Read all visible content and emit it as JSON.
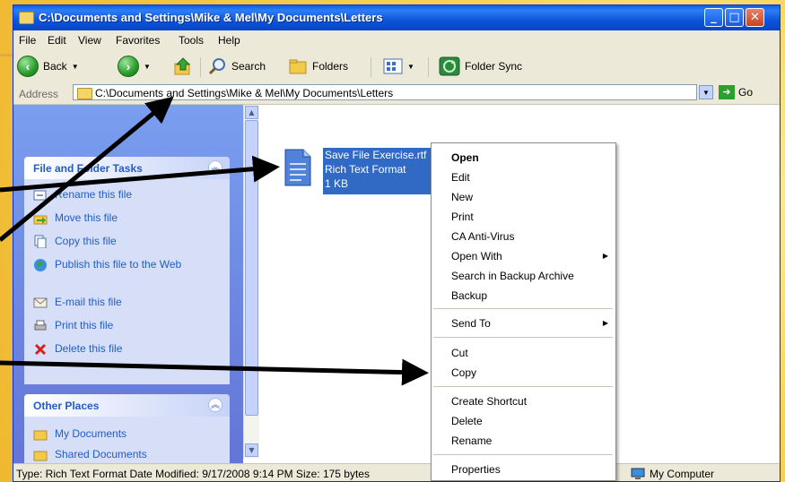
{
  "window": {
    "title": "C:\\Documents and Settings\\Mike & Mel\\My Documents\\Letters"
  },
  "menubar": [
    "File",
    "Edit",
    "View",
    "Favorites",
    "Tools",
    "Help"
  ],
  "toolbar": {
    "back": "Back",
    "search": "Search",
    "folders": "Folders",
    "folder_sync": "Folder Sync"
  },
  "address": {
    "label": "Address",
    "value": "C:\\Documents and Settings\\Mike & Mel\\My Documents\\Letters",
    "go": "Go"
  },
  "tasks": {
    "title": "File and Folder Tasks",
    "items": [
      {
        "label": "Rename this file",
        "icon": "rename-icon"
      },
      {
        "label": "Move this file",
        "icon": "move-icon"
      },
      {
        "label": "Copy this file",
        "icon": "copy-icon"
      },
      {
        "label": "Publish this file to the Web",
        "icon": "publish-icon"
      },
      {
        "label": "E-mail this file",
        "icon": "email-icon"
      },
      {
        "label": "Print this file",
        "icon": "print-icon"
      },
      {
        "label": "Delete this file",
        "icon": "delete-icon"
      }
    ]
  },
  "other_places": {
    "title": "Other Places",
    "items": [
      {
        "label": "My Documents"
      },
      {
        "label": "Shared Documents"
      }
    ]
  },
  "file": {
    "name": "Save File Exercise.rtf",
    "type": "Rich Text Format",
    "size": "1 KB"
  },
  "context_menu": {
    "open": "Open",
    "edit": "Edit",
    "new": "New",
    "print": "Print",
    "antivirus": "CA Anti-Virus",
    "open_with": "Open With",
    "search_backup": "Search in Backup Archive",
    "backup": "Backup",
    "send_to": "Send To",
    "cut": "Cut",
    "copy": "Copy",
    "create_shortcut": "Create Shortcut",
    "delete": "Delete",
    "rename": "Rename",
    "properties": "Properties"
  },
  "status": {
    "text": "Type: Rich Text Format Date Modified: 9/17/2008 9:14 PM Size: 175 bytes",
    "zone": "My Computer"
  },
  "colors": {
    "titlebar": "#0a5fe6",
    "selection": "#316ac5",
    "taskpane": "#6375d6",
    "task_link": "#215dc6"
  }
}
